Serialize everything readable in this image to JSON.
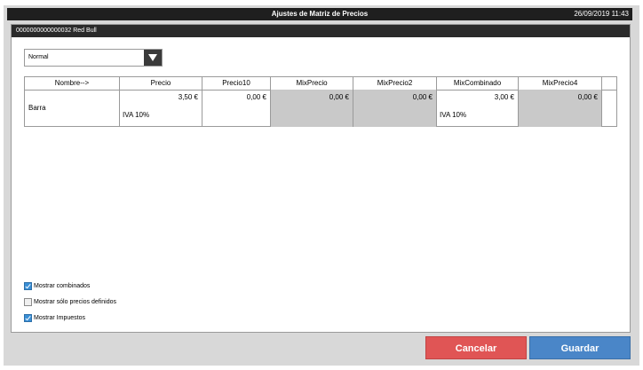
{
  "window": {
    "title": "Ajustes de Matriz de Precios",
    "datetime": "26/09/2019 11:43"
  },
  "product": {
    "header": "0000000000000032 Red Bull"
  },
  "dropdown": {
    "selected": "Normal"
  },
  "grid": {
    "columns": [
      "Nombre-->",
      "Precio",
      "Precio10",
      "MixPrecio",
      "MixPrecio2",
      "MixCombinado",
      "MixPrecio4"
    ],
    "rows": [
      {
        "name": "Barra",
        "cells": [
          {
            "price": "3,50 €",
            "tax": "IVA 10%",
            "disabled": false
          },
          {
            "price": "0,00 €",
            "tax": "",
            "disabled": false
          },
          {
            "price": "0,00 €",
            "tax": "",
            "disabled": true
          },
          {
            "price": "0,00 €",
            "tax": "",
            "disabled": true
          },
          {
            "price": "3,00 €",
            "tax": "IVA 10%",
            "disabled": false
          },
          {
            "price": "0,00 €",
            "tax": "",
            "disabled": true
          }
        ]
      }
    ]
  },
  "options": [
    {
      "label": "Mostrar combinados",
      "checked": true
    },
    {
      "label": "Mostrar sólo precios definidos",
      "checked": false
    },
    {
      "label": "Mostrar Impuestos",
      "checked": true
    }
  ],
  "buttons": {
    "cancel": "Cancelar",
    "save": "Guardar"
  }
}
